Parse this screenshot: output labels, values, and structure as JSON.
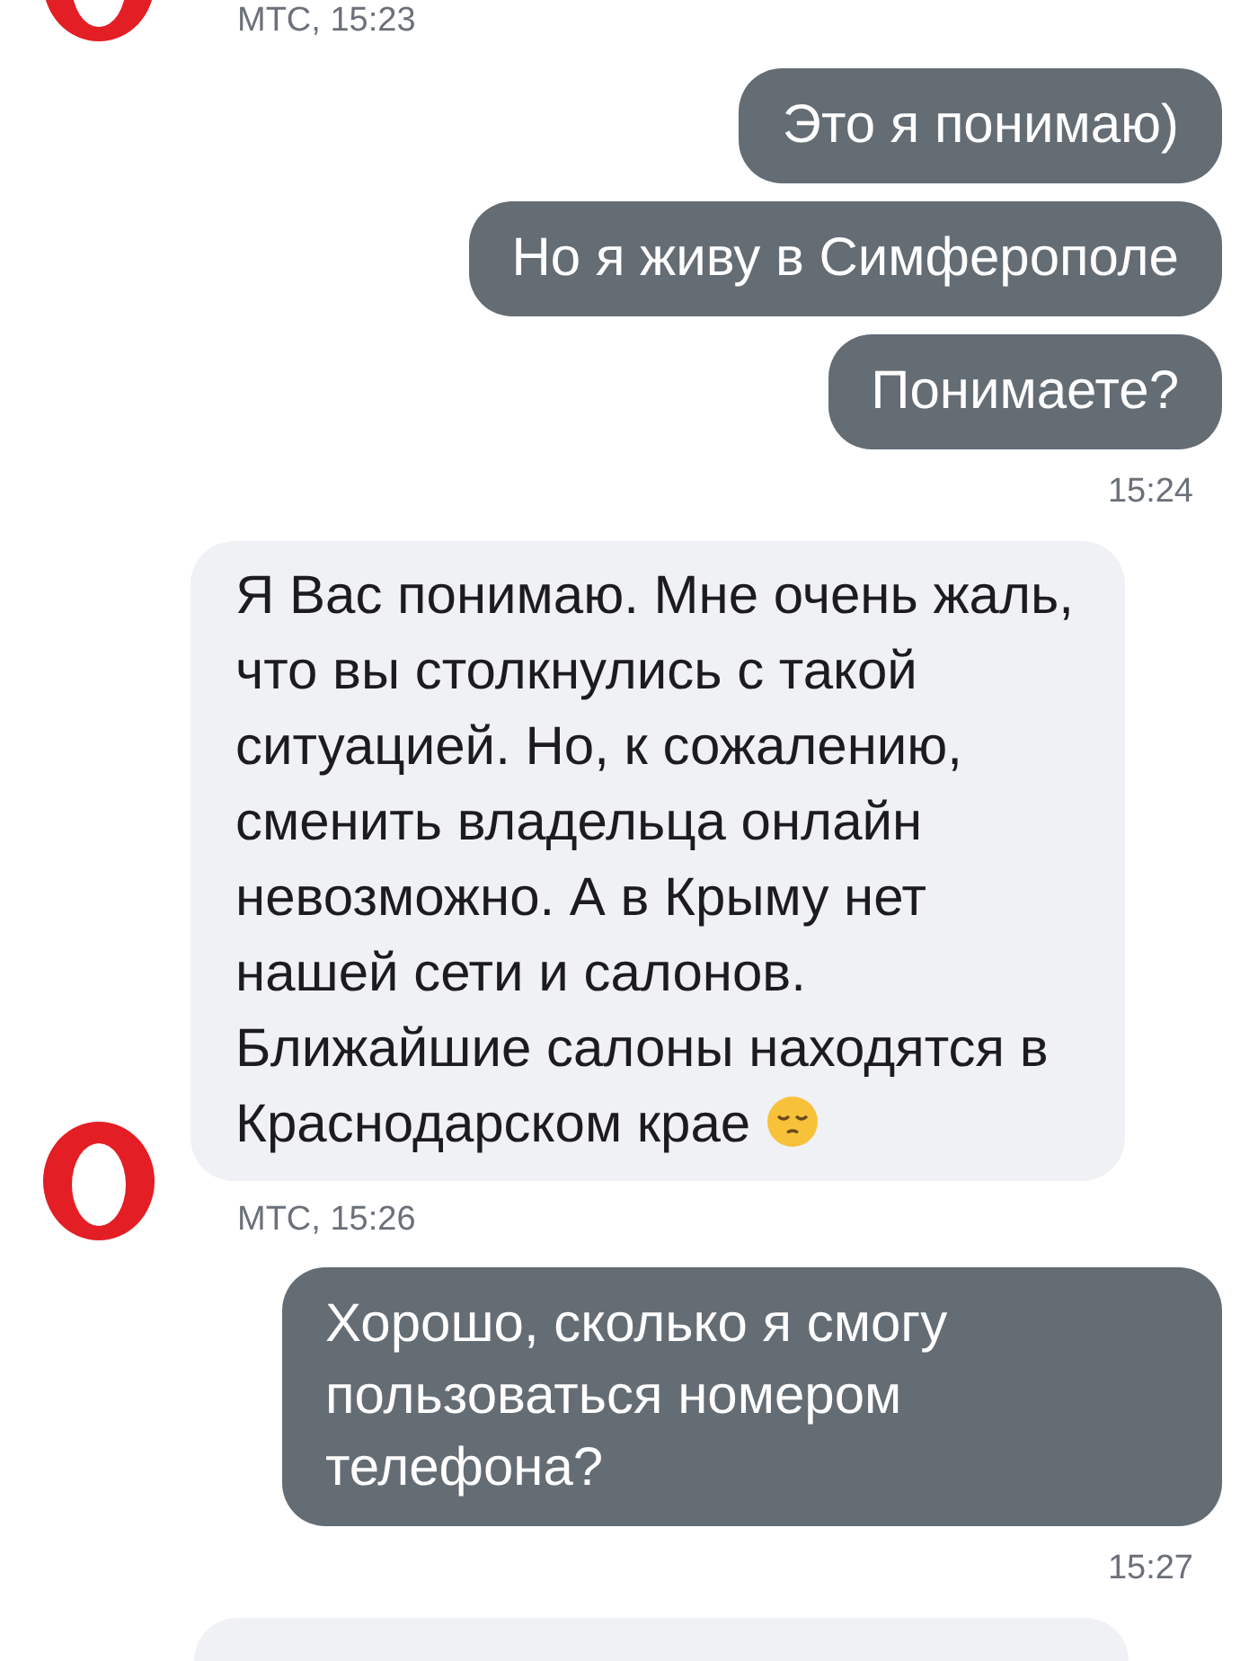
{
  "messages": [
    {
      "kind": "in",
      "meta": "МТС, 15:23"
    },
    {
      "kind": "out",
      "text": "Это я понимаю)"
    },
    {
      "kind": "out",
      "text": "Но я живу в Симферополе"
    },
    {
      "kind": "out",
      "text": "Понимаете?"
    },
    {
      "kind": "time",
      "text": "15:24"
    },
    {
      "kind": "in",
      "text": "Я Вас понимаю. Мне очень жаль, что вы столкнулись с такой ситуацией. Но, к сожалению, сменить владельца онлайн невозможно. А в Крыму нет нашей сети и салонов. Ближайшие салоны находятся в Краснодарском крае",
      "trailing_icon": {
        "kind": "pensive"
      },
      "meta": "МТС, 15:26"
    },
    {
      "kind": "out",
      "text": "Хорошо, сколько я смогу пользоваться номером телефона?"
    },
    {
      "kind": "time",
      "text": "15:27"
    },
    {
      "kind": "in_cut"
    }
  ]
}
